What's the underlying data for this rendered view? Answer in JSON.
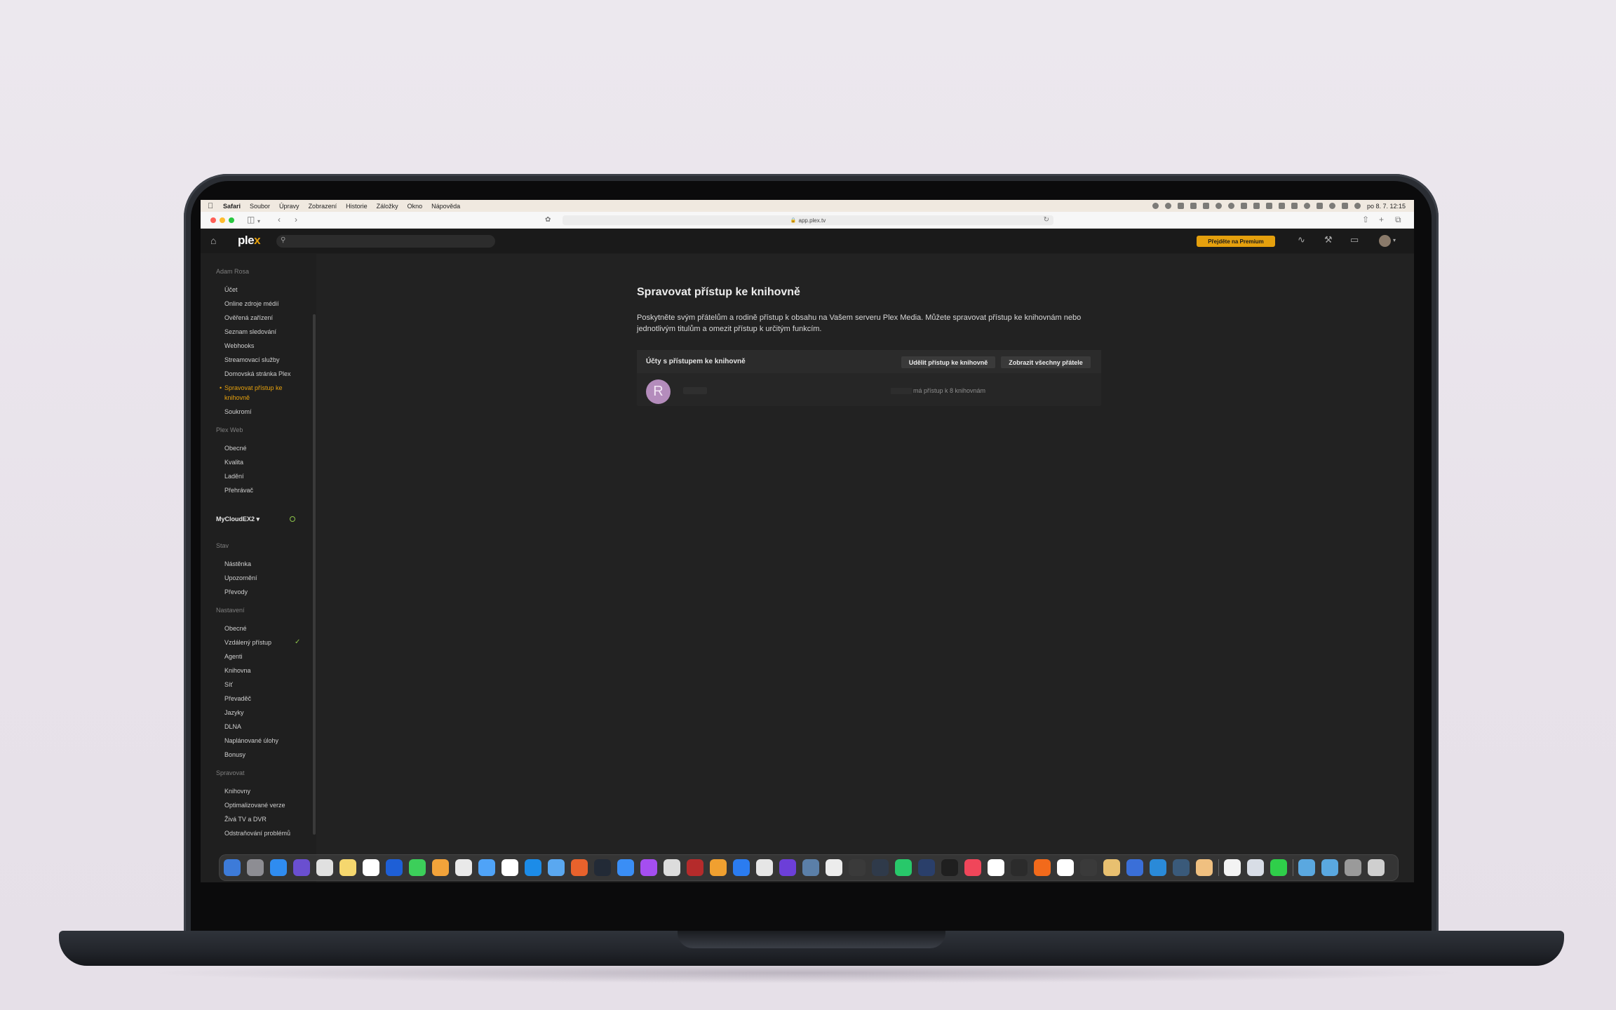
{
  "menubar": {
    "items": [
      "Safari",
      "Soubor",
      "Úpravy",
      "Zobrazení",
      "Historie",
      "Záložky",
      "Okno",
      "Nápověda"
    ],
    "clock": "po 8. 7. 12:15"
  },
  "browser": {
    "url": "app.plex.tv"
  },
  "header": {
    "logo_main": "ple",
    "logo_x": "x",
    "premium_label": "Přejděte na Premium"
  },
  "sidebar": {
    "account_name": "Adam Rosa",
    "account_items": [
      "Účet",
      "Online zdroje médií",
      "Ověřená zařízení",
      "Seznam sledování",
      "Webhooks",
      "Streamovací služby",
      "Domovská stránka Plex"
    ],
    "active_item_line1": "Spravovat přístup ke",
    "active_item_line2": "knihovně",
    "after_active": "Soukromí",
    "plexweb_head": "Plex Web",
    "plexweb_items": [
      "Obecné",
      "Kvalita",
      "Ladění",
      "Přehrávač"
    ],
    "server_name": "MyCloudEX2 ▾",
    "status_head": "Stav",
    "status_items": [
      "Nástěnka",
      "Upozornění",
      "Převody"
    ],
    "settings_head": "Nastavení",
    "settings_items": [
      "Obecné",
      "Vzdálený přístup",
      "Agenti",
      "Knihovna",
      "Síť",
      "Převaděč",
      "Jazyky",
      "DLNA",
      "Naplánované úlohy",
      "Bonusy"
    ],
    "manage_head": "Spravovat",
    "manage_items": [
      "Knihovny",
      "Optimalizované verze",
      "Živá TV a DVR",
      "Odstraňování problémů"
    ]
  },
  "main": {
    "title": "Spravovat přístup ke knihovně",
    "description": "Poskytněte svým přátelům a rodině přístup k obsahu na Vašem serveru Plex Media. Můžete spravovat přístup ke knihovnám nebo jednotlivým titulům a omezit přístup k určitým funkcím.",
    "panel_title": "Účty s přístupem ke knihovně",
    "grant_button": "Udělit přístup ke knihovně",
    "friends_button": "Zobrazit všechny přátele",
    "row": {
      "avatar_letter": "R",
      "access_text": "má přístup k 8 knihovnám"
    }
  },
  "colors": {
    "accent": "#e5a00d",
    "online": "#8cc34a",
    "avatar": "#b48cbc"
  }
}
